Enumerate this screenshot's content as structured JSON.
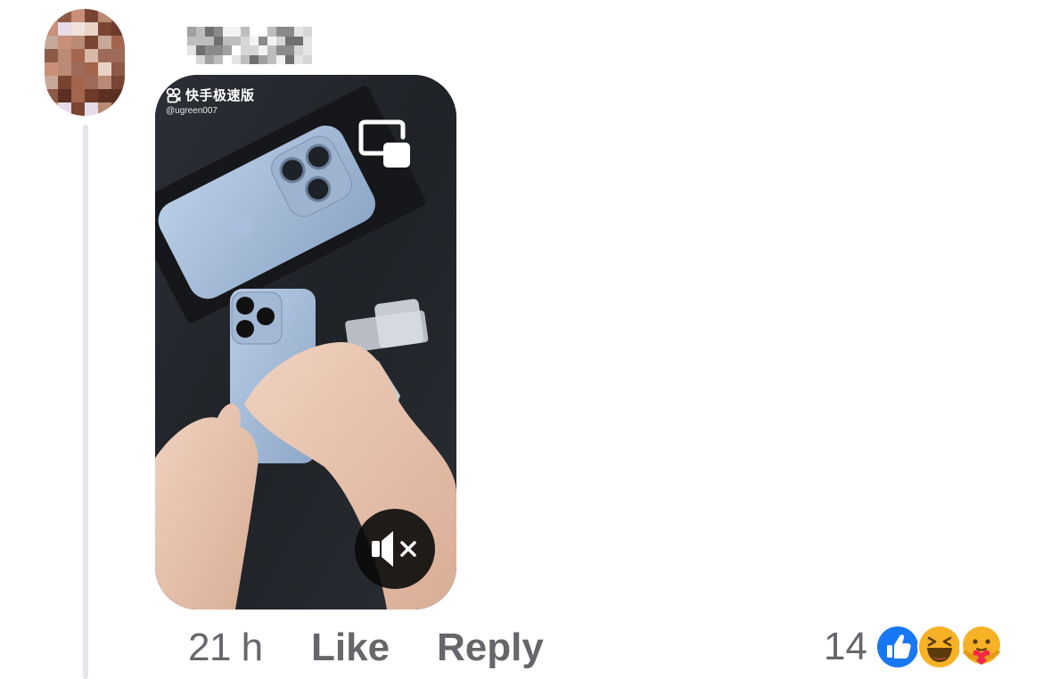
{
  "comment": {
    "video": {
      "brand_name": "快手极速版",
      "handle": "@ugreen007",
      "pip_icon": "picture-in-picture-icon",
      "mute_icon": "muted-speaker-icon"
    },
    "meta": {
      "timestamp": "21 h",
      "like_label": "Like",
      "reply_label": "Reply",
      "reaction_count": "14",
      "reactions": [
        "like-reaction-icon",
        "haha-reaction-icon",
        "care-reaction-icon"
      ]
    }
  },
  "colors": {
    "secondary_text": "#65676b",
    "thread_line": "#e4e6eb",
    "like_blue": "#1877f2",
    "reaction_yellow": "#f7b125"
  }
}
